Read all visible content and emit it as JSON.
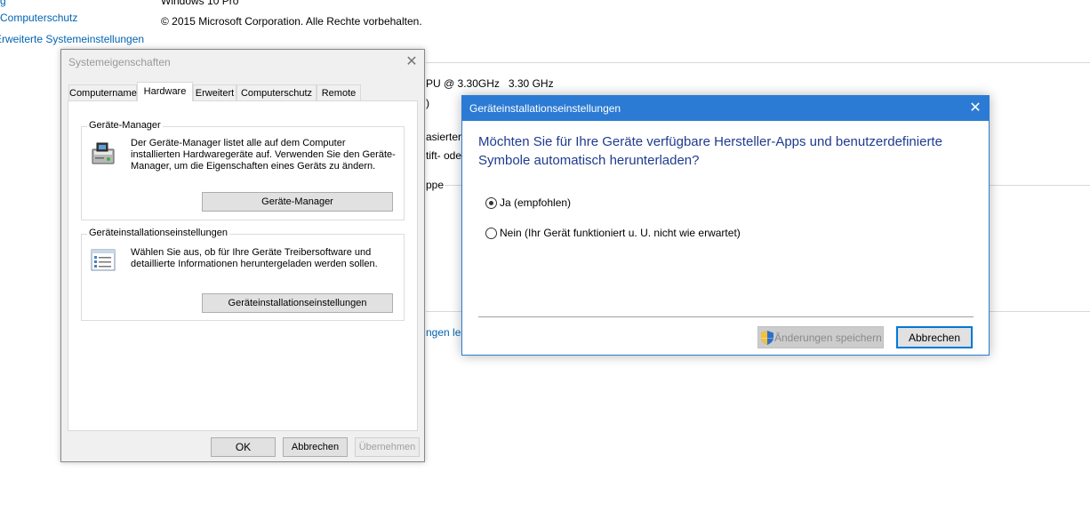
{
  "background": {
    "left_links": [
      "Computerschutz",
      "Erweiterte Systemeinstellungen"
    ],
    "windows_edition": "Windows 10 Pro",
    "copyright": "© 2015 Microsoft Corporation. Alle Rechte vorbehalten.",
    "cpu_fragment": "PU @ 3.30GHz   3.30 GHz",
    "frag_paren": ")",
    "frag_basiert": "asierter",
    "frag_stift": "tift- ode",
    "frag_ppe": "ppe",
    "frag_link": "ngen les"
  },
  "system_properties": {
    "title": "Systemeigenschaften",
    "tabs": [
      "Computername",
      "Hardware",
      "Erweitert",
      "Computerschutz",
      "Remote"
    ],
    "active_tab": "Hardware",
    "device_manager": {
      "legend": "Geräte-Manager",
      "description": "Der Geräte-Manager listet alle auf dem Computer installierten Hardwaregeräte auf. Verwenden Sie den Geräte-Manager, um die Eigenschaften eines Geräts zu ändern.",
      "button": "Geräte-Manager",
      "icon": "device-manager-icon"
    },
    "device_installation": {
      "legend": "Geräteinstallationseinstellungen",
      "description": "Wählen Sie aus, ob für Ihre Geräte Treibersoftware und detaillierte Informationen heruntergeladen werden sollen.",
      "button": "Geräteinstallationseinstellungen",
      "icon": "settings-list-icon"
    },
    "buttons": {
      "ok": "OK",
      "cancel": "Abbrechen",
      "apply": "Übernehmen"
    }
  },
  "dialog": {
    "title": "Geräteinstallationseinstellungen",
    "question": "Möchten Sie für Ihre Geräte verfügbare Hersteller-Apps und benutzerdefinierte Symbole automatisch herunterladen?",
    "options": [
      "Ja (empfohlen)",
      "Nein (Ihr Gerät funktioniert u. U. nicht wie erwartet)"
    ],
    "selected": "Ja (empfohlen)",
    "save_button": "Änderungen speichern",
    "cancel_button": "Abbrechen",
    "shield_icon": "uac-shield-icon",
    "accent": "#2b7bd4",
    "question_color": "#1e3b8f"
  }
}
